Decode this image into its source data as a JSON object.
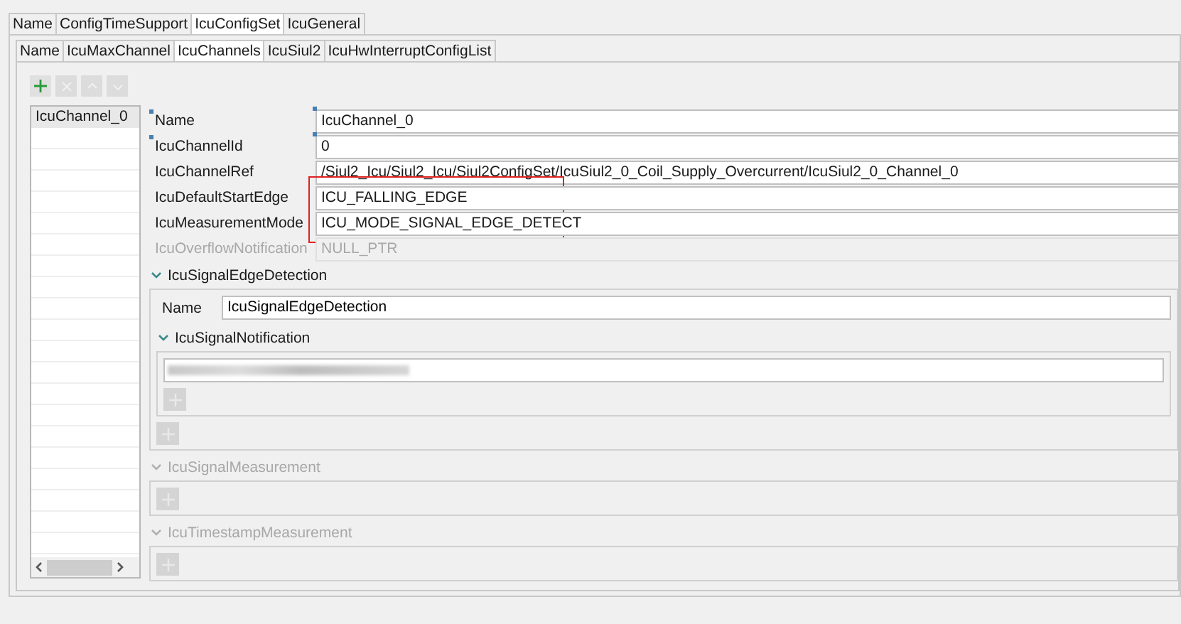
{
  "outer_tabs": [
    {
      "label": "Name",
      "selected": false
    },
    {
      "label": "ConfigTimeSupport",
      "selected": false
    },
    {
      "label": "IcuConfigSet",
      "selected": true
    },
    {
      "label": "IcuGeneral",
      "selected": false
    }
  ],
  "inner_tabs": [
    {
      "label": "Name",
      "selected": false
    },
    {
      "label": "IcuMaxChannel",
      "selected": false
    },
    {
      "label": "IcuChannels",
      "selected": true
    },
    {
      "label": "IcuSiul2",
      "selected": false
    },
    {
      "label": "IcuHwInterruptConfigList",
      "selected": false
    }
  ],
  "toolbar": [
    {
      "kind": "add",
      "disabled": false
    },
    {
      "kind": "remove",
      "disabled": true
    },
    {
      "kind": "up",
      "disabled": true
    },
    {
      "kind": "down",
      "disabled": true
    }
  ],
  "channel_list": [
    {
      "label": "IcuChannel_0",
      "selected": true
    }
  ],
  "fields": [
    {
      "label": "Name",
      "value": "IcuChannel_0",
      "required": true,
      "disabled": false,
      "highlighted": false
    },
    {
      "label": "IcuChannelId",
      "value": "0",
      "required": true,
      "disabled": false,
      "highlighted": false
    },
    {
      "label": "IcuChannelRef",
      "value": "/Siul2_Icu/Siul2_Icu/Siul2ConfigSet/IcuSiul2_0_Coil_Supply_Overcurrent/IcuSiul2_0_Channel_0",
      "required": false,
      "disabled": false,
      "highlighted": false
    },
    {
      "label": "IcuDefaultStartEdge",
      "value": "ICU_FALLING_EDGE",
      "required": false,
      "disabled": false,
      "highlighted": true
    },
    {
      "label": "IcuMeasurementMode",
      "value": "ICU_MODE_SIGNAL_EDGE_DETECT",
      "required": false,
      "disabled": false,
      "highlighted": true
    },
    {
      "label": "IcuOverflowNotification",
      "value": "NULL_PTR",
      "required": false,
      "disabled": true,
      "highlighted": false
    }
  ],
  "sections": [
    {
      "title": "IcuSignalEdgeDetection",
      "expanded": true,
      "disabled": false,
      "name_field": {
        "label": "Name",
        "value": "IcuSignalEdgeDetection"
      },
      "subsections": [
        {
          "title": "IcuSignalNotification",
          "expanded": true,
          "disabled": false,
          "entries": [
            {
              "kind": "blurred"
            }
          ],
          "add_disabled": true
        }
      ],
      "add_disabled": true
    },
    {
      "title": "IcuSignalMeasurement",
      "expanded": true,
      "disabled": true,
      "add_disabled": true
    },
    {
      "title": "IcuTimestampMeasurement",
      "expanded": true,
      "disabled": true,
      "add_disabled": true
    }
  ]
}
